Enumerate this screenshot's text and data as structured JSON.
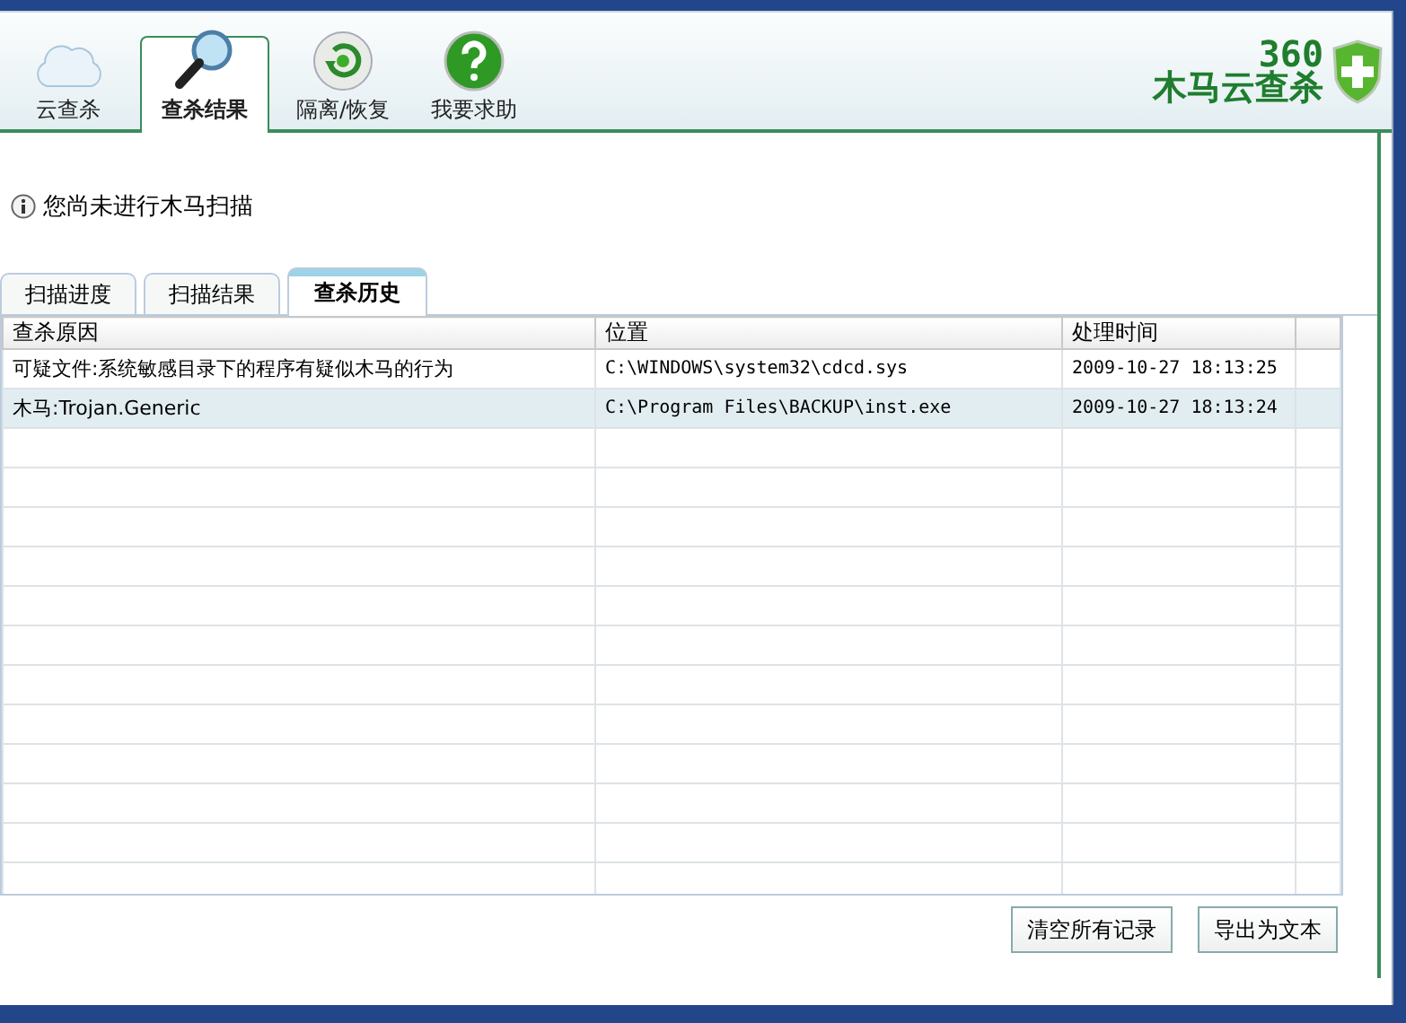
{
  "toolbar": {
    "tabs": [
      {
        "label": "云查杀",
        "selected": false
      },
      {
        "label": "查杀结果",
        "selected": true
      },
      {
        "label": "隔离/恢复",
        "selected": false
      },
      {
        "label": "我要求助",
        "selected": false
      }
    ],
    "logo": {
      "line_1": "360",
      "line_2": "木马云查杀"
    }
  },
  "status": "您尚未进行木马扫描",
  "subtabs": [
    {
      "label": "扫描进度",
      "selected": false
    },
    {
      "label": "扫描结果",
      "selected": false
    },
    {
      "label": "查杀历史",
      "selected": true
    }
  ],
  "table": {
    "columns": [
      "查杀原因",
      "位置",
      "处理时间"
    ],
    "rows": [
      {
        "cells": [
          "可疑文件:系统敏感目录下的程序有疑似木马的行为",
          "C:\\WINDOWS\\system32\\cdcd.sys",
          "2009-10-27 18:13:25"
        ],
        "selected": false
      },
      {
        "cells": [
          "木马:Trojan.Generic",
          "C:\\Program Files\\BACKUP\\inst.exe",
          "2009-10-27 18:13:24"
        ],
        "selected": true
      }
    ]
  },
  "buttons": [
    "清空所有记录",
    "导出为文本"
  ]
}
